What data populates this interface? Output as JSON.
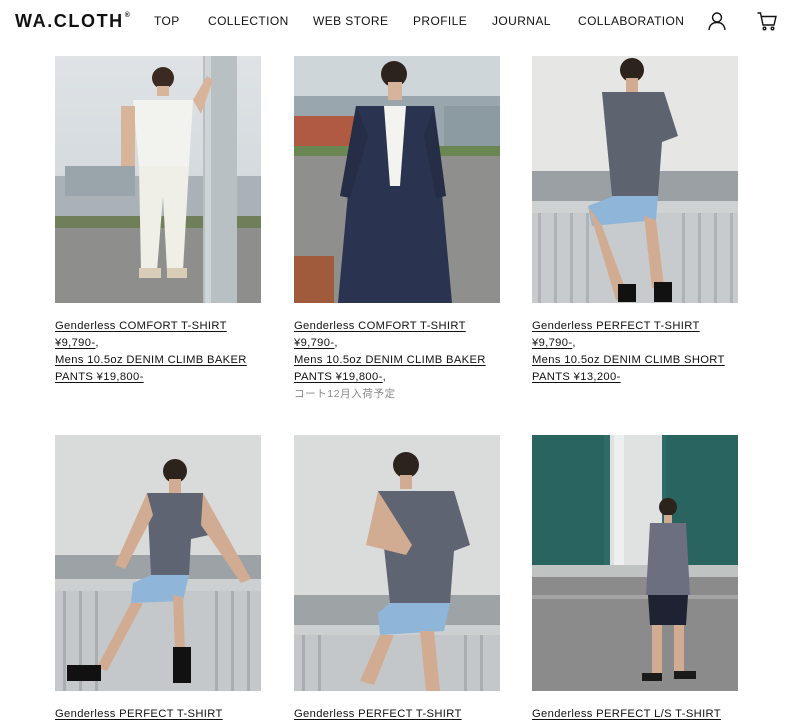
{
  "brand": {
    "logo_text": "WA.CLOTH",
    "logo_mark": "®"
  },
  "nav": {
    "items": [
      {
        "label": "TOP"
      },
      {
        "label": "COLLECTION"
      },
      {
        "label": "WEB STORE"
      },
      {
        "label": "PROFILE"
      },
      {
        "label": "JOURNAL"
      },
      {
        "label": "COLLABORATION"
      }
    ],
    "icons": {
      "account": "user-icon",
      "cart": "cart-icon"
    }
  },
  "products": [
    {
      "photo": "model in white t-shirt and white denim leaning on pole",
      "lines": [
        {
          "text": "Genderless COMFORT T-SHIRT",
          "link": true
        },
        {
          "text": "¥9,790-",
          "link": true,
          "suffix": ","
        },
        {
          "text": "Mens 10.5oz DENIM CLIMB BAKER",
          "link": true
        },
        {
          "text": "PANTS ¥19,800-",
          "link": true
        }
      ]
    },
    {
      "photo": "model in navy long coat at harbor",
      "lines": [
        {
          "text": "Genderless COMFORT T-SHIRT",
          "link": true
        },
        {
          "text": "¥9,790-",
          "link": true,
          "suffix": ","
        },
        {
          "text": "Mens 10.5oz DENIM CLIMB BAKER",
          "link": true
        },
        {
          "text": "PANTS ¥19,800-",
          "link": true,
          "suffix": ","
        }
      ],
      "note": "コート12月入荷予定"
    },
    {
      "photo": "model in grey t-shirt and denim shorts sitting on railing",
      "lines": [
        {
          "text": "Genderless PERFECT T-SHIRT",
          "link": true
        },
        {
          "text": "¥9,790-",
          "link": true,
          "suffix": ","
        },
        {
          "text": "Mens 10.5oz DENIM CLIMB SHORT",
          "link": true
        },
        {
          "text": "PANTS ¥13,200-",
          "link": true
        }
      ]
    },
    {
      "photo": "model in grey t-shirt sitting on railing",
      "lines": [
        {
          "text": "Genderless PERFECT T-SHIRT",
          "link": true
        }
      ]
    },
    {
      "photo": "model in grey t-shirt sitting on railing looking down",
      "lines": [
        {
          "text": "Genderless PERFECT T-SHIRT",
          "link": true
        }
      ]
    },
    {
      "photo": "model in long sleeve t-shirt standing by teal wall",
      "lines": [
        {
          "text": "Genderless PERFECT L/S T-SHIRT",
          "link": true
        }
      ]
    }
  ],
  "colors": {
    "text": "#111111",
    "note": "#888888",
    "background": "#ffffff"
  }
}
